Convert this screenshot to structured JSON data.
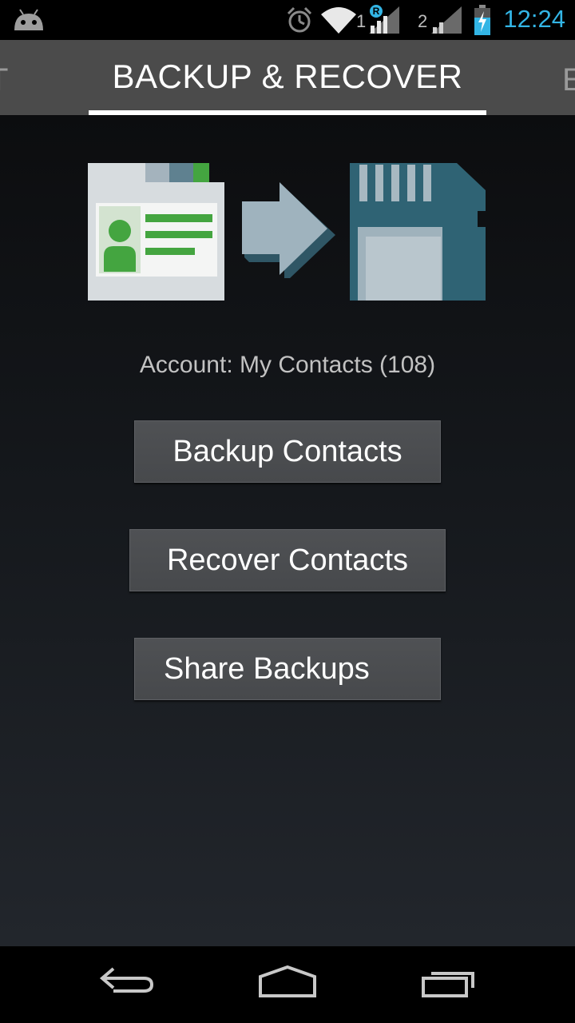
{
  "status_bar": {
    "time": "12:24",
    "sim1_label": "1",
    "sim2_label": "2",
    "roaming_label": "R",
    "icons": [
      "android-icon",
      "alarm-icon",
      "wifi-icon",
      "signal-icon",
      "battery-charging-icon"
    ],
    "accent": "#33b5e5"
  },
  "tabs": {
    "left_partial": "T",
    "active": "BACKUP & RECOVER",
    "right_partial": "E"
  },
  "main": {
    "hero_icons": [
      "contact-card-icon",
      "arrow-right-icon",
      "sd-card-icon"
    ],
    "account_text": "Account: My Contacts (108)",
    "buttons": {
      "backup": "Backup Contacts",
      "recover": "Recover Contacts",
      "share": "Share Backups"
    }
  },
  "nav": {
    "icons": [
      "back-icon",
      "home-icon",
      "recents-icon"
    ]
  }
}
